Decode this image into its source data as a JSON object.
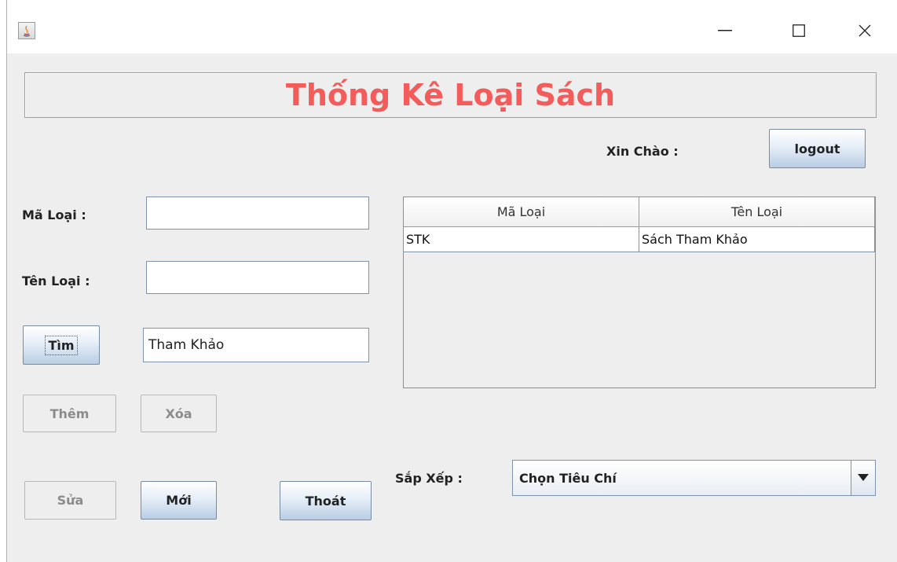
{
  "window": {
    "minimize_glyph": "—",
    "maximize_glyph": "☐",
    "close_glyph": "✕"
  },
  "banner": {
    "title": "Thống Kê Loại Sách",
    "color": "#f45b5b"
  },
  "greeting": {
    "label": "Xin Chào :"
  },
  "buttons": {
    "logout": "logout",
    "tim": "Tìm",
    "them": "Thêm",
    "xoa": "Xóa",
    "sua": "Sửa",
    "moi": "Mới",
    "thoat": "Thoát"
  },
  "form": {
    "ma_loai_label": "Mã Loại :",
    "ma_loai_value": "",
    "ten_loai_label": "Tên Loại :",
    "ten_loai_value": "",
    "search_value": "Tham Khảo"
  },
  "table": {
    "columns": [
      "Mã Loại",
      "Tên Loại"
    ],
    "rows": [
      [
        "STK",
        "Sách Tham Khảo"
      ]
    ]
  },
  "sort": {
    "label": "Sắp Xếp :",
    "selected": "Chọn Tiêu Chí"
  }
}
